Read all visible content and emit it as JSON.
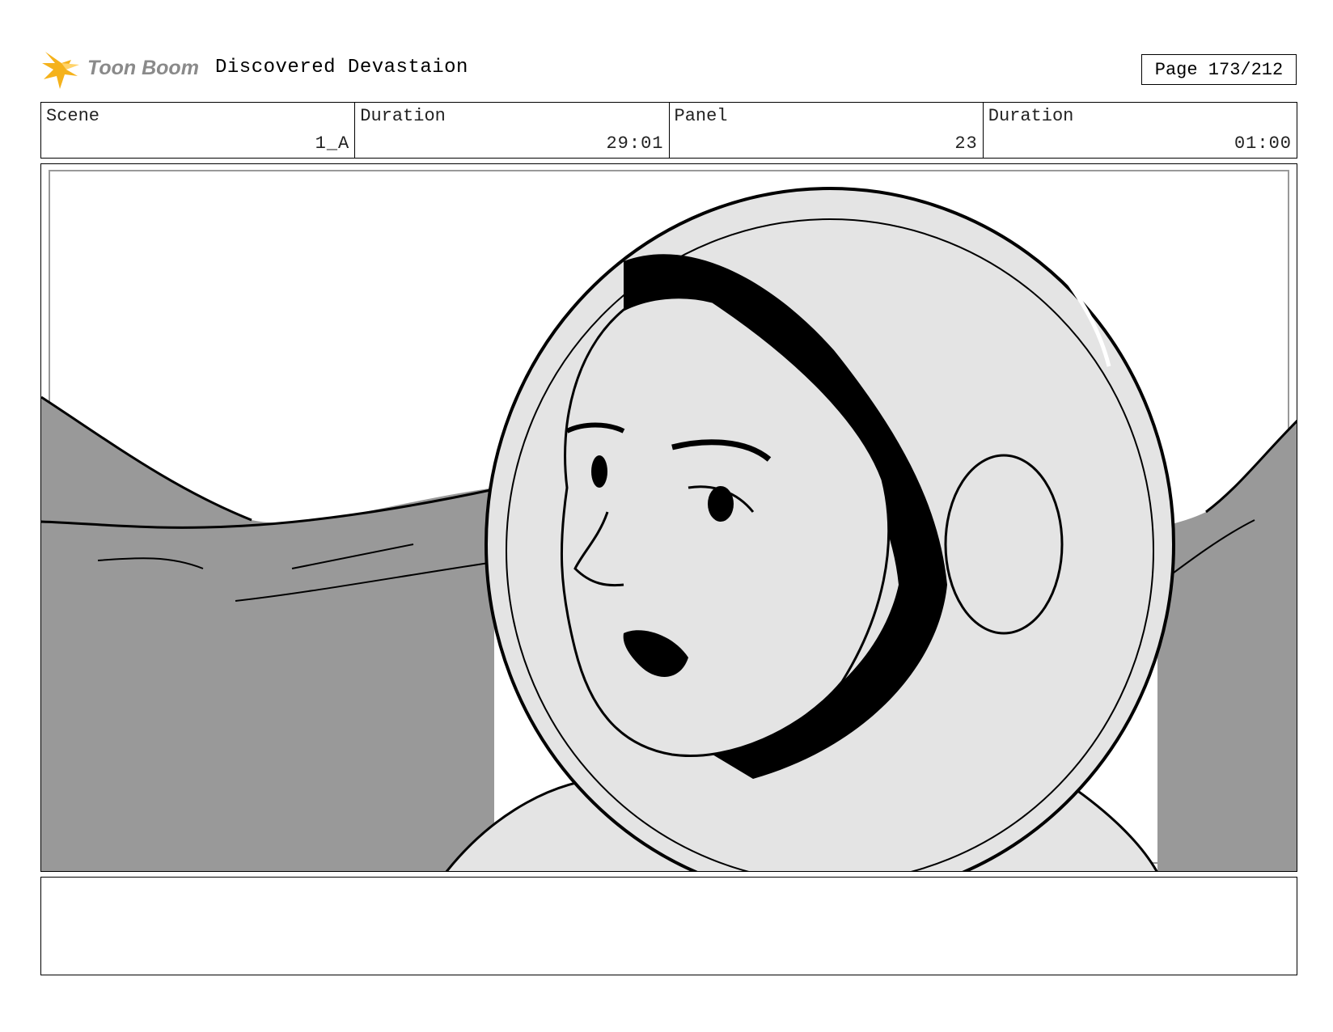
{
  "header": {
    "logo_text": "Toon Boom",
    "title": "Discovered Devastaion",
    "page_label": "Page 173/212"
  },
  "info": [
    {
      "label": "Scene",
      "value": "1_A"
    },
    {
      "label": "Duration",
      "value": "29:01"
    },
    {
      "label": "Panel",
      "value": "23"
    },
    {
      "label": "Duration",
      "value": "01:00"
    }
  ],
  "notes": {
    "text": ""
  },
  "colors": {
    "logo_star": "#F5B21B",
    "logo_text": "#8A8A8A",
    "hills": "#999999",
    "helmet": "#E4E4E4",
    "ink": "#000000"
  }
}
